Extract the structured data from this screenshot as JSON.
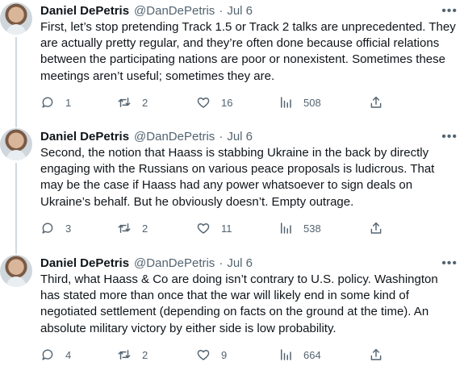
{
  "author": {
    "name": "Daniel DePetris",
    "handle": "@DanDePetris"
  },
  "separator": "·",
  "more_glyph": "•••",
  "tweets": [
    {
      "date": "Jul 6",
      "text": "First, let’s stop pretending Track 1.5 or Track 2 talks are unprecedented. They are actually pretty regular, and they’re often done because official relations between the participating nations are poor or nonexistent. Sometimes these meetings aren’t useful; sometimes they are.",
      "replies": "1",
      "retweets": "2",
      "likes": "16",
      "views": "508"
    },
    {
      "date": "Jul 6",
      "text": "Second, the notion that Haass is stabbing Ukraine in the back by directly engaging with the Russians on various peace proposals is ludicrous. That may be the case if Haass had any power whatsoever to sign deals on Ukraine’s behalf. But he obviously doesn’t. Empty outrage.",
      "replies": "3",
      "retweets": "2",
      "likes": "11",
      "views": "538"
    },
    {
      "date": "Jul 6",
      "text": "Third, what Haass & Co are doing isn’t contrary to U.S. policy. Washington has stated more than once that the war will likely end in some kind of negotiated settlement (depending on facts on the ground at the time). An absolute military victory by either side is low probability.",
      "replies": "4",
      "retweets": "2",
      "likes": "9",
      "views": "664"
    }
  ],
  "icons": {
    "reply": "reply-icon",
    "retweet": "retweet-icon",
    "like": "heart-icon",
    "views": "views-icon",
    "share": "share-icon",
    "more": "more-icon"
  },
  "colors": {
    "text": "#0f1419",
    "secondary": "#536471",
    "thread_line": "#cfd9de",
    "background": "#ffffff"
  }
}
